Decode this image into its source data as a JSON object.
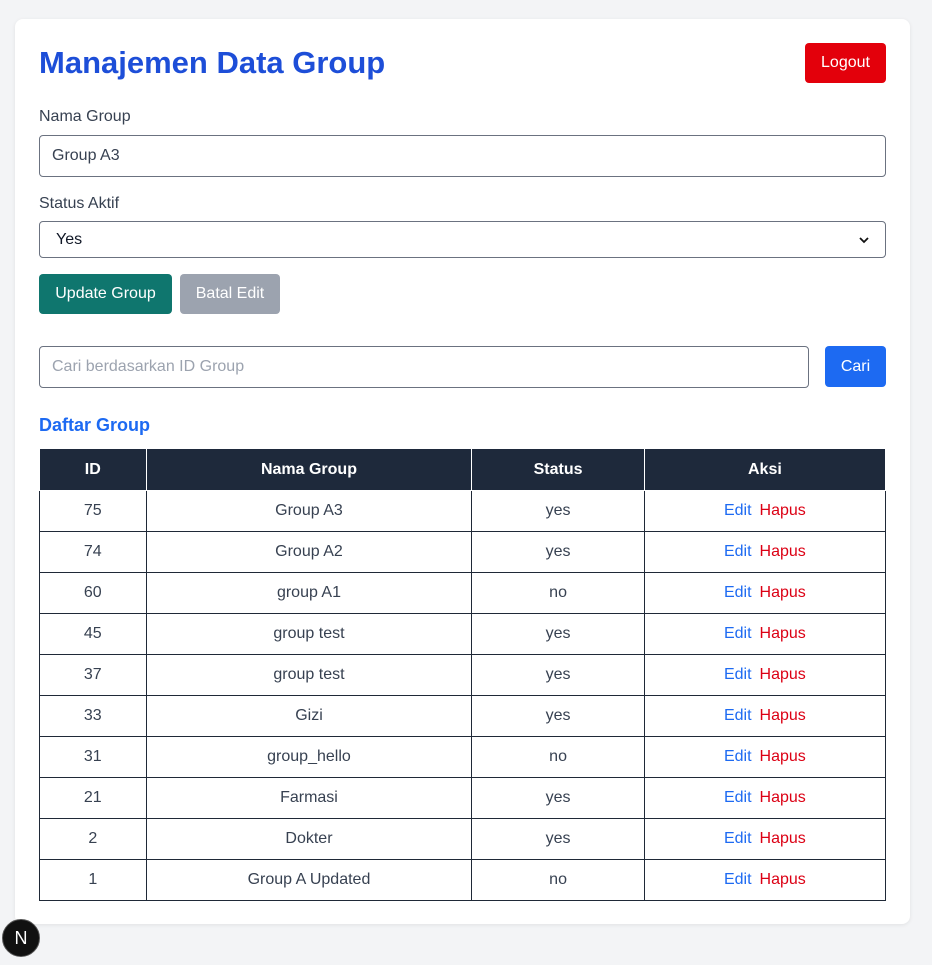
{
  "header": {
    "title": "Manajemen Data Group",
    "logout_label": "Logout"
  },
  "form": {
    "name_label": "Nama Group",
    "name_value": "Group A3",
    "status_label": "Status Aktif",
    "status_value": "Yes",
    "update_label": "Update Group",
    "cancel_label": "Batal Edit"
  },
  "search": {
    "placeholder": "Cari berdasarkan ID Group",
    "button_label": "Cari"
  },
  "list": {
    "title": "Daftar Group",
    "columns": [
      "ID",
      "Nama Group",
      "Status",
      "Aksi"
    ],
    "edit_label": "Edit",
    "delete_label": "Hapus",
    "rows": [
      {
        "id": "75",
        "name": "Group A3",
        "status": "yes"
      },
      {
        "id": "74",
        "name": "Group A2",
        "status": "yes"
      },
      {
        "id": "60",
        "name": "group A1",
        "status": "no"
      },
      {
        "id": "45",
        "name": "group test",
        "status": "yes"
      },
      {
        "id": "37",
        "name": "group test",
        "status": "yes"
      },
      {
        "id": "33",
        "name": "Gizi",
        "status": "yes"
      },
      {
        "id": "31",
        "name": "group_hello",
        "status": "no"
      },
      {
        "id": "21",
        "name": "Farmasi",
        "status": "yes"
      },
      {
        "id": "2",
        "name": "Dokter",
        "status": "yes"
      },
      {
        "id": "1",
        "name": "Group A Updated",
        "status": "no"
      }
    ]
  },
  "badge": {
    "icon": "nextjs-icon",
    "letter": "N"
  },
  "colors": {
    "title": "#1d4ed8",
    "logout": "#e3000b",
    "update": "#0f766e",
    "cancel": "#9ca3af",
    "primary": "#1d6af2",
    "table_header": "#1e293b",
    "delete": "#dc0014"
  }
}
